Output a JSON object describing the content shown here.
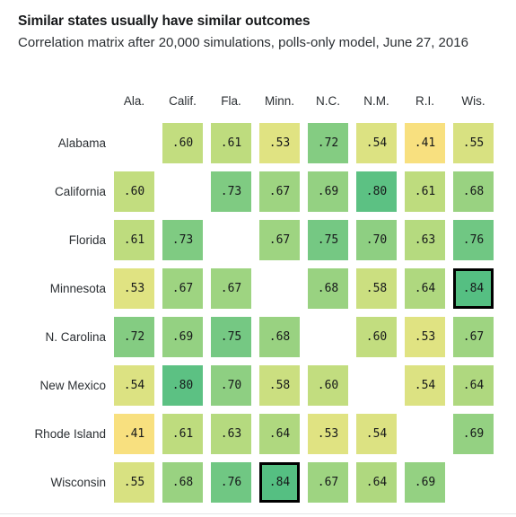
{
  "header": {
    "title": "Similar states usually have similar outcomes",
    "subtitle": "Correlation matrix after 20,000 simulations, polls-only model, June 27, 2016"
  },
  "colors": {
    "low": "#fae07f",
    "mid": "#c5de82",
    "high": "#5cc183",
    "highlight_border": "#000000",
    "text": "#16181a",
    "rule": "#e4e6e8"
  },
  "chart_data": {
    "type": "heatmap",
    "title": "Similar states usually have similar outcomes",
    "subtitle": "Correlation matrix after 20,000 simulations, polls-only model, June 27, 2016",
    "xlabel": "",
    "ylabel": "",
    "grid": false,
    "legend": "none",
    "value_range": [
      0.41,
      0.84
    ],
    "diagonal": "blank",
    "symmetric": true,
    "column_labels": [
      "Ala.",
      "Calif.",
      "Fla.",
      "Minn.",
      "N.C.",
      "N.M.",
      "R.I.",
      "Wis."
    ],
    "row_labels": [
      "Alabama",
      "California",
      "Florida",
      "Minnesota",
      "N. Carolina",
      "New Mexico",
      "Rhode Island",
      "Wisconsin"
    ],
    "highlighted_cells": [
      [
        3,
        7
      ],
      [
        7,
        3
      ]
    ],
    "rows": [
      {
        "label": "Alabama",
        "cells": [
          {
            "text": "",
            "value": null
          },
          {
            "text": ".60",
            "value": 0.6
          },
          {
            "text": ".61",
            "value": 0.61
          },
          {
            "text": ".53",
            "value": 0.53
          },
          {
            "text": ".72",
            "value": 0.72
          },
          {
            "text": ".54",
            "value": 0.54
          },
          {
            "text": ".41",
            "value": 0.41
          },
          {
            "text": ".55",
            "value": 0.55
          }
        ]
      },
      {
        "label": "California",
        "cells": [
          {
            "text": ".60",
            "value": 0.6
          },
          {
            "text": "",
            "value": null
          },
          {
            "text": ".73",
            "value": 0.73
          },
          {
            "text": ".67",
            "value": 0.67
          },
          {
            "text": ".69",
            "value": 0.69
          },
          {
            "text": ".80",
            "value": 0.8
          },
          {
            "text": ".61",
            "value": 0.61
          },
          {
            "text": ".68",
            "value": 0.68
          }
        ]
      },
      {
        "label": "Florida",
        "cells": [
          {
            "text": ".61",
            "value": 0.61
          },
          {
            "text": ".73",
            "value": 0.73
          },
          {
            "text": "",
            "value": null
          },
          {
            "text": ".67",
            "value": 0.67
          },
          {
            "text": ".75",
            "value": 0.75
          },
          {
            "text": ".70",
            "value": 0.7
          },
          {
            "text": ".63",
            "value": 0.63
          },
          {
            "text": ".76",
            "value": 0.76
          }
        ]
      },
      {
        "label": "Minnesota",
        "cells": [
          {
            "text": ".53",
            "value": 0.53
          },
          {
            "text": ".67",
            "value": 0.67
          },
          {
            "text": ".67",
            "value": 0.67
          },
          {
            "text": "",
            "value": null
          },
          {
            "text": ".68",
            "value": 0.68
          },
          {
            "text": ".58",
            "value": 0.58
          },
          {
            "text": ".64",
            "value": 0.64
          },
          {
            "text": ".84",
            "value": 0.84,
            "highlight": true
          }
        ]
      },
      {
        "label": "N. Carolina",
        "cells": [
          {
            "text": ".72",
            "value": 0.72
          },
          {
            "text": ".69",
            "value": 0.69
          },
          {
            "text": ".75",
            "value": 0.75
          },
          {
            "text": ".68",
            "value": 0.68
          },
          {
            "text": "",
            "value": null
          },
          {
            "text": ".60",
            "value": 0.6
          },
          {
            "text": ".53",
            "value": 0.53
          },
          {
            "text": ".67",
            "value": 0.67
          }
        ]
      },
      {
        "label": "New Mexico",
        "cells": [
          {
            "text": ".54",
            "value": 0.54
          },
          {
            "text": ".80",
            "value": 0.8
          },
          {
            "text": ".70",
            "value": 0.7
          },
          {
            "text": ".58",
            "value": 0.58
          },
          {
            "text": ".60",
            "value": 0.6
          },
          {
            "text": "",
            "value": null
          },
          {
            "text": ".54",
            "value": 0.54
          },
          {
            "text": ".64",
            "value": 0.64
          }
        ]
      },
      {
        "label": "Rhode Island",
        "cells": [
          {
            "text": ".41",
            "value": 0.41
          },
          {
            "text": ".61",
            "value": 0.61
          },
          {
            "text": ".63",
            "value": 0.63
          },
          {
            "text": ".64",
            "value": 0.64
          },
          {
            "text": ".53",
            "value": 0.53
          },
          {
            "text": ".54",
            "value": 0.54
          },
          {
            "text": "",
            "value": null
          },
          {
            "text": ".69",
            "value": 0.69
          }
        ]
      },
      {
        "label": "Wisconsin",
        "cells": [
          {
            "text": ".55",
            "value": 0.55
          },
          {
            "text": ".68",
            "value": 0.68
          },
          {
            "text": ".76",
            "value": 0.76
          },
          {
            "text": ".84",
            "value": 0.84,
            "highlight": true
          },
          {
            "text": ".67",
            "value": 0.67
          },
          {
            "text": ".64",
            "value": 0.64
          },
          {
            "text": ".69",
            "value": 0.69
          },
          {
            "text": "",
            "value": null
          }
        ]
      }
    ]
  }
}
